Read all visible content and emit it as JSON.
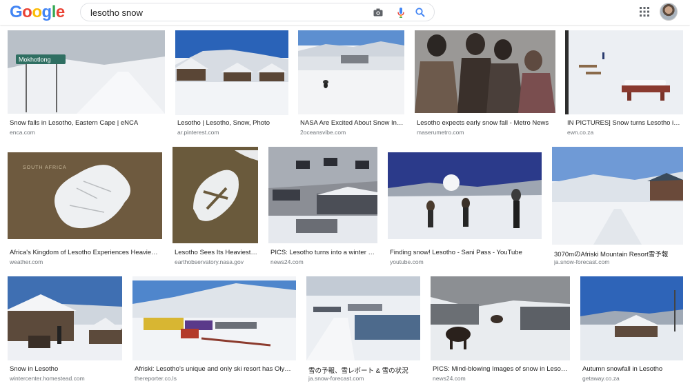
{
  "logo": {
    "letters": [
      "G",
      "o",
      "o",
      "g",
      "l",
      "e"
    ]
  },
  "search": {
    "query": "lesotho snow"
  },
  "results": [
    {
      "title": "Snow falls in Lesotho, Eastern Cape | eNCA",
      "domain": "enca.com",
      "sign_text": "Mokhotlong"
    },
    {
      "title": "Lesotho | Lesotho, Snow, Photo",
      "domain": "ar.pinterest.com"
    },
    {
      "title": "NASA Are Excited About Snow In L...",
      "domain": "2oceansvibe.com"
    },
    {
      "title": "Lesotho expects early snow fall - Metro News",
      "domain": "maserumetro.com"
    },
    {
      "title": "IN PICTURES] Snow turns Lesotho into...",
      "domain": "ewn.co.za"
    },
    {
      "title": "Africa's Kingdom of Lesotho Experiences Heaviest ...",
      "domain": "weather.com",
      "map_text": "SOUTH AFRICA"
    },
    {
      "title": "Lesotho Sees Its Heaviest ...",
      "domain": "earthobservatory.nasa.gov"
    },
    {
      "title": "PICS: Lesotho turns into a winter w...",
      "domain": "news24.com"
    },
    {
      "title": "Finding snow! Lesotho - Sani Pass - YouTube",
      "domain": "youtube.com"
    },
    {
      "title": "3070mのAfriski Mountain Resort雪予報",
      "domain": "ja.snow-forecast.com"
    },
    {
      "title": "Snow in Lesotho",
      "domain": "wintercenter.homestead.com"
    },
    {
      "title": "Afriski: Lesotho's unique and only ski resort has Olymp...",
      "domain": "thereporter.co.ls"
    },
    {
      "title": "雪の予報、雪レポート & 雪の状況",
      "domain": "ja.snow-forecast.com"
    },
    {
      "title": "PICS: Mind-blowing Images of snow in Lesoth...",
      "domain": "news24.com"
    },
    {
      "title": "Autumn snowfall in Lesotho",
      "domain": "getaway.co.za"
    }
  ],
  "colors": {
    "google_blue": "#4285F4",
    "google_red": "#EA4335",
    "google_yellow": "#FBBC05",
    "google_green": "#34A853",
    "domain_gray": "#70757a"
  }
}
